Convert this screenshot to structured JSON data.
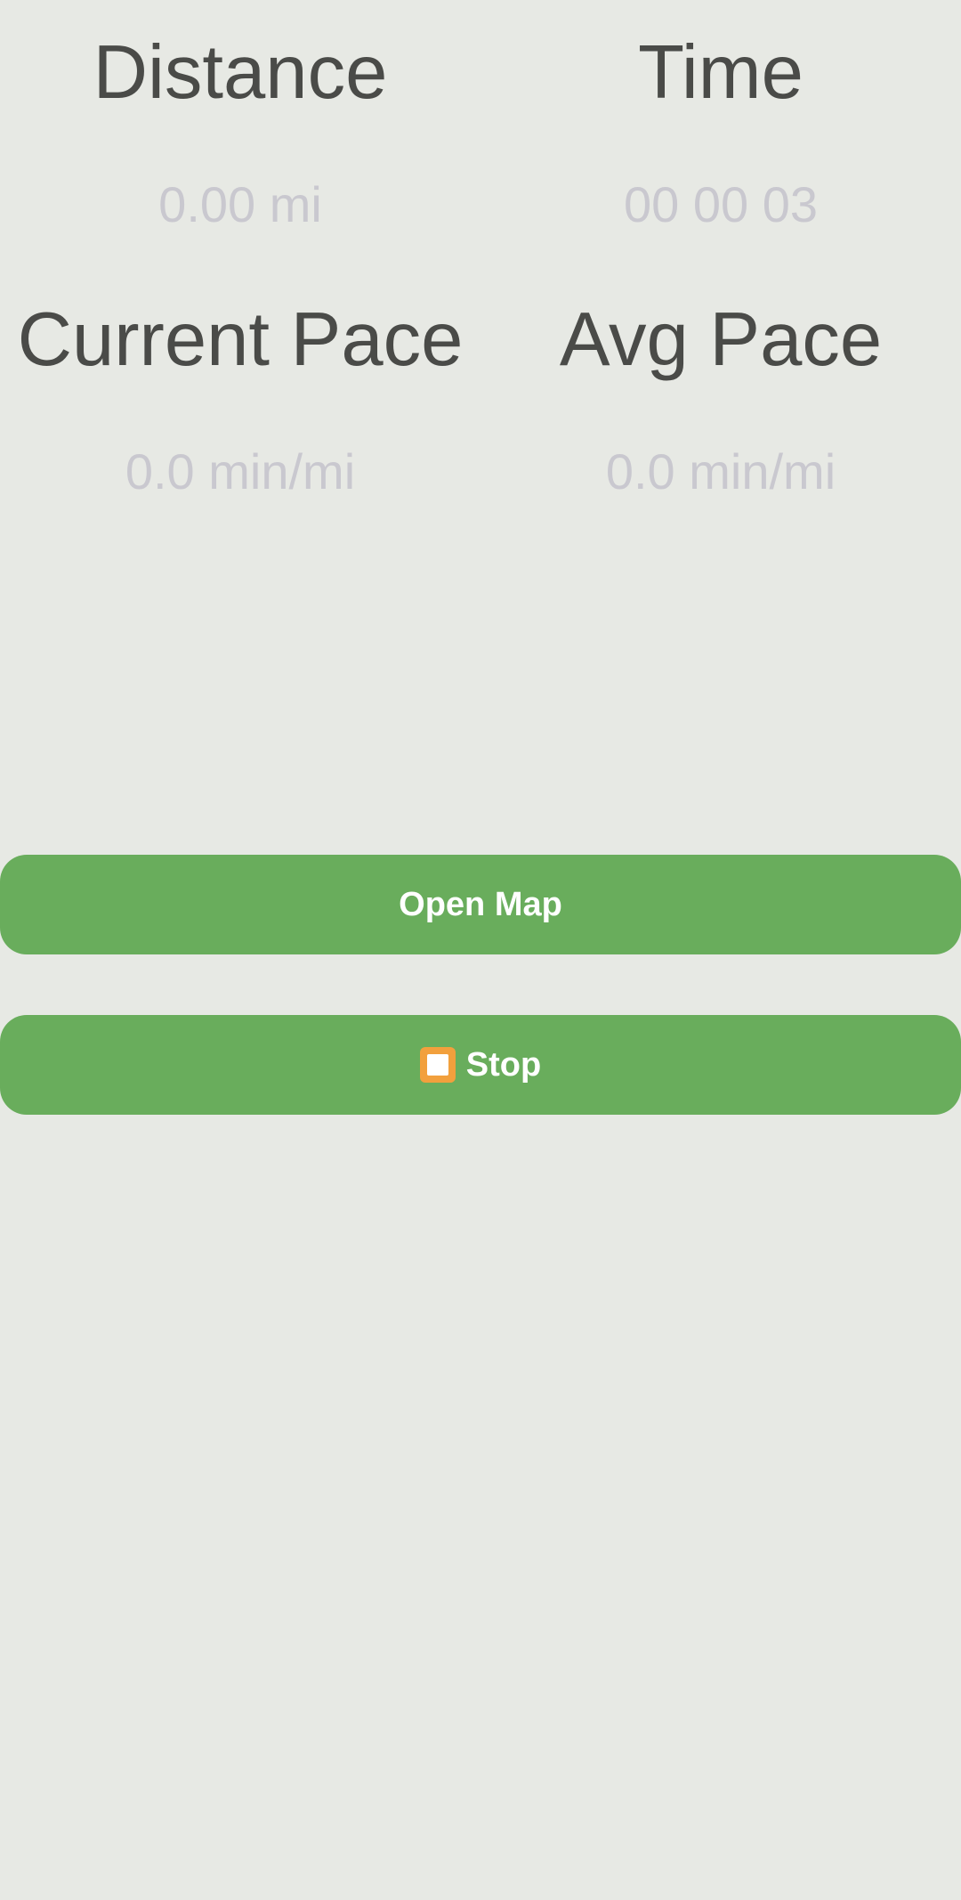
{
  "stats": {
    "distance": {
      "label": "Distance",
      "value": "0.00 mi"
    },
    "time": {
      "label": "Time",
      "value": "00 00 03"
    },
    "current_pace": {
      "label": "Current Pace",
      "value": "0.0 min/mi"
    },
    "avg_pace": {
      "label": "Avg Pace",
      "value": "0.0 min/mi"
    }
  },
  "buttons": {
    "open_map": {
      "label": "Open Map"
    },
    "stop": {
      "label": "Stop",
      "icon": "stop-square-icon"
    }
  },
  "colors": {
    "background": "#e7e9e4",
    "button": "#69ad5c",
    "label_text": "#4a4b48",
    "value_text": "#c9c8cf"
  }
}
